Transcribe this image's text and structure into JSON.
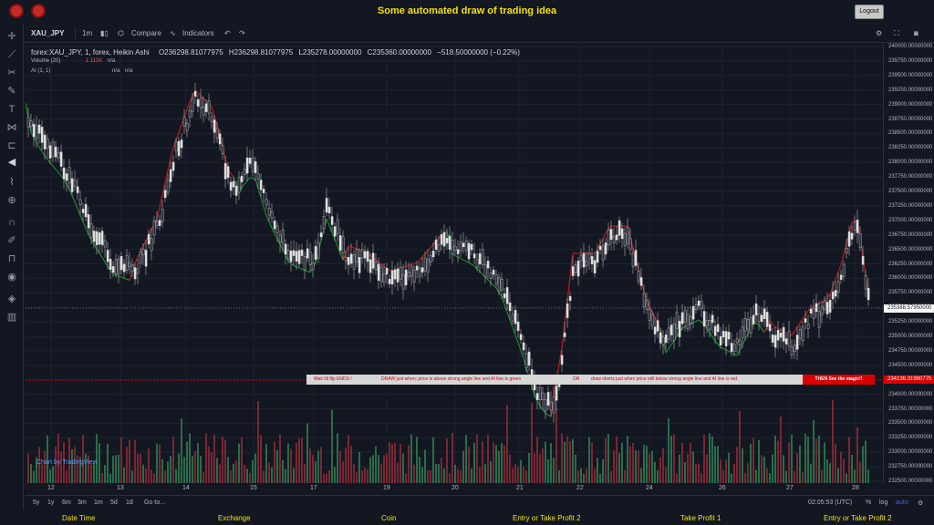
{
  "app": {
    "title": "Some automated draw of trading idea",
    "logout_label": "Logout"
  },
  "toolbar": {
    "symbol": "XAU_JPY",
    "interval": "1m",
    "compare_label": "Compare",
    "indicators_label": "Indicators"
  },
  "legend": {
    "main": "forex:XAU_JPY, 1, forex, Heikin Ashi",
    "open": "O236298.81077975",
    "high": "H236298.81077975",
    "low": "L235278.00000000",
    "close": "C235360.00000000",
    "change": "−518.50000000 (−0.22%)",
    "volume_label": "Volume (20)",
    "volume_value": "1.111K",
    "volume_na": "n/a",
    "ai_label": "AI (1, 1)",
    "ai_na1": "n/a",
    "ai_na2": "n/a"
  },
  "price_axis": {
    "labels": [
      "240000.00000000",
      "239750.00000000",
      "239500.00000000",
      "239250.00000000",
      "239000.00000000",
      "238750.00000000",
      "238500.00000000",
      "238250.00000000",
      "238000.00000000",
      "237750.00000000",
      "237500.00000000",
      "237250.00000000",
      "237000.00000000",
      "236750.00000000",
      "236500.00000000",
      "236250.00000000",
      "236000.00000000",
      "235750.00000000",
      "235500.00000000",
      "235250.00000000",
      "235000.00000000",
      "234750.00000000",
      "234500.00000000",
      "234250.00000000",
      "234000.00000000",
      "233750.00000000",
      "233500.00000000",
      "233250.00000000",
      "233000.00000000",
      "232750.00000000",
      "232500.00000000"
    ],
    "last_price": "235388.57950000",
    "line_price": "234136.31980775"
  },
  "date_axis": {
    "labels": [
      "12",
      "13",
      "14",
      "15",
      "17",
      "19",
      "20",
      "21",
      "22",
      "24",
      "26",
      "27",
      "28"
    ]
  },
  "bottom": {
    "ranges": [
      "5y",
      "1y",
      "6m",
      "3m",
      "1m",
      "5d",
      "1d"
    ],
    "goto": "Go to...",
    "time": "02:05:53 (UTC)",
    "percent": "%",
    "log": "log",
    "auto": "auto"
  },
  "banner": {
    "part1": "Wait till flip ENDS !",
    "part2": "DRAW just when:  price is above strong angle line and AI line is green",
    "part3": "OR",
    "part4": "draw shorts just when price still below strong angle line and AI line is red",
    "end": "THEN See the magic!!"
  },
  "watermark": "Chart by TradingView",
  "status": [
    "Date Time",
    "Exchange",
    "Coin",
    "Entry or Take Profit 2",
    "Take Profit 1",
    "Entry or Take Profit 2"
  ],
  "colors": {
    "up": "#e0e0e0",
    "down": "#2a2e39",
    "ai_red": "#b71c1c",
    "ai_green": "#1b8a2e",
    "vol_up": "#2e7d4f",
    "vol_down": "#8b2a35",
    "accent_yellow": "#f5e100"
  }
}
